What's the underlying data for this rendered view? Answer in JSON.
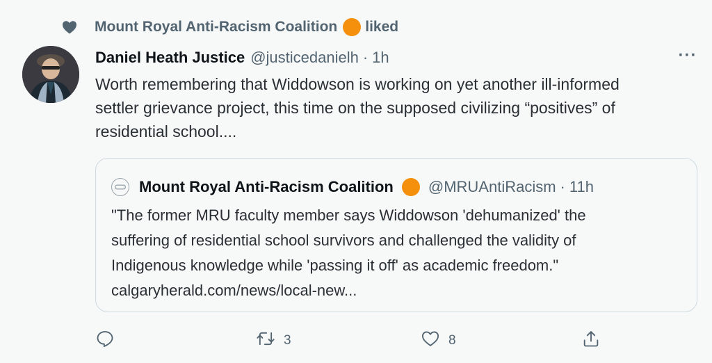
{
  "social_context": {
    "name": "Mount Royal Anti-Racism Coalition",
    "action": "liked",
    "icon": "heart-icon"
  },
  "tweet": {
    "display_name": "Daniel Heath Justice",
    "handle": "@justicedanielh",
    "separator": "·",
    "time": "1h",
    "more": "···",
    "lines": [
      "Worth remembering that Widdowson is working on yet another ill-informed",
      "settler grievance project, this time on the supposed civilizing “positives” of",
      "residential school...."
    ]
  },
  "quote": {
    "display_name": "Mount Royal Anti-Racism Coalition",
    "handle": "@MRUAntiRacism",
    "separator": "·",
    "time": "11h",
    "lines": [
      "\"The former MRU faculty member says Widdowson 'dehumanized' the",
      "suffering of residential school survivors and challenged the validity of",
      "Indigenous knowledge while 'passing it off' as academic freedom.\"",
      "calgaryherald.com/news/local-new..."
    ]
  },
  "actions": {
    "reply": {
      "icon": "reply-icon",
      "count": ""
    },
    "retweet": {
      "icon": "retweet-icon",
      "count": "3"
    },
    "like": {
      "icon": "heart-icon",
      "count": "8"
    },
    "share": {
      "icon": "share-icon",
      "count": ""
    }
  },
  "colors": {
    "badge": "#f4900c",
    "muted": "#536471",
    "text": "#0f1419",
    "border": "#cfd9de",
    "background": "#f7f9f9"
  }
}
